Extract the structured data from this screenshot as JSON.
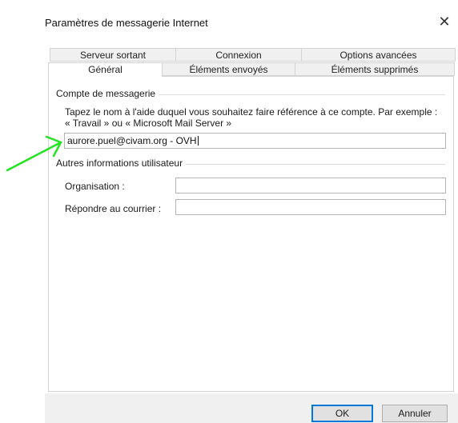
{
  "window": {
    "title": "Paramètres de messagerie Internet",
    "close_glyph": "✕"
  },
  "tabs_row1": [
    {
      "label": "Serveur sortant"
    },
    {
      "label": "Connexion"
    },
    {
      "label": "Options avancées"
    }
  ],
  "tabs_row2": [
    {
      "label": "Général",
      "active": true
    },
    {
      "label": "Éléments envoyés"
    },
    {
      "label": "Éléments supprimés"
    }
  ],
  "account": {
    "group_label": "Compte de messagerie",
    "description": "Tapez le nom à l'aide duquel vous souhaitez faire référence à ce compte. Par exemple : « Travail » ou « Microsoft Mail Server »",
    "name_value": "aurore.puel@civam.org - OVH"
  },
  "user_info": {
    "group_label": "Autres informations utilisateur",
    "organisation_label": "Organisation :",
    "organisation_value": "",
    "reply_label": "Répondre au courrier :",
    "reply_value": ""
  },
  "buttons": {
    "ok": "OK",
    "cancel": "Annuler"
  },
  "annotation": {
    "color": "#22e422",
    "icon": "arrow-icon"
  }
}
